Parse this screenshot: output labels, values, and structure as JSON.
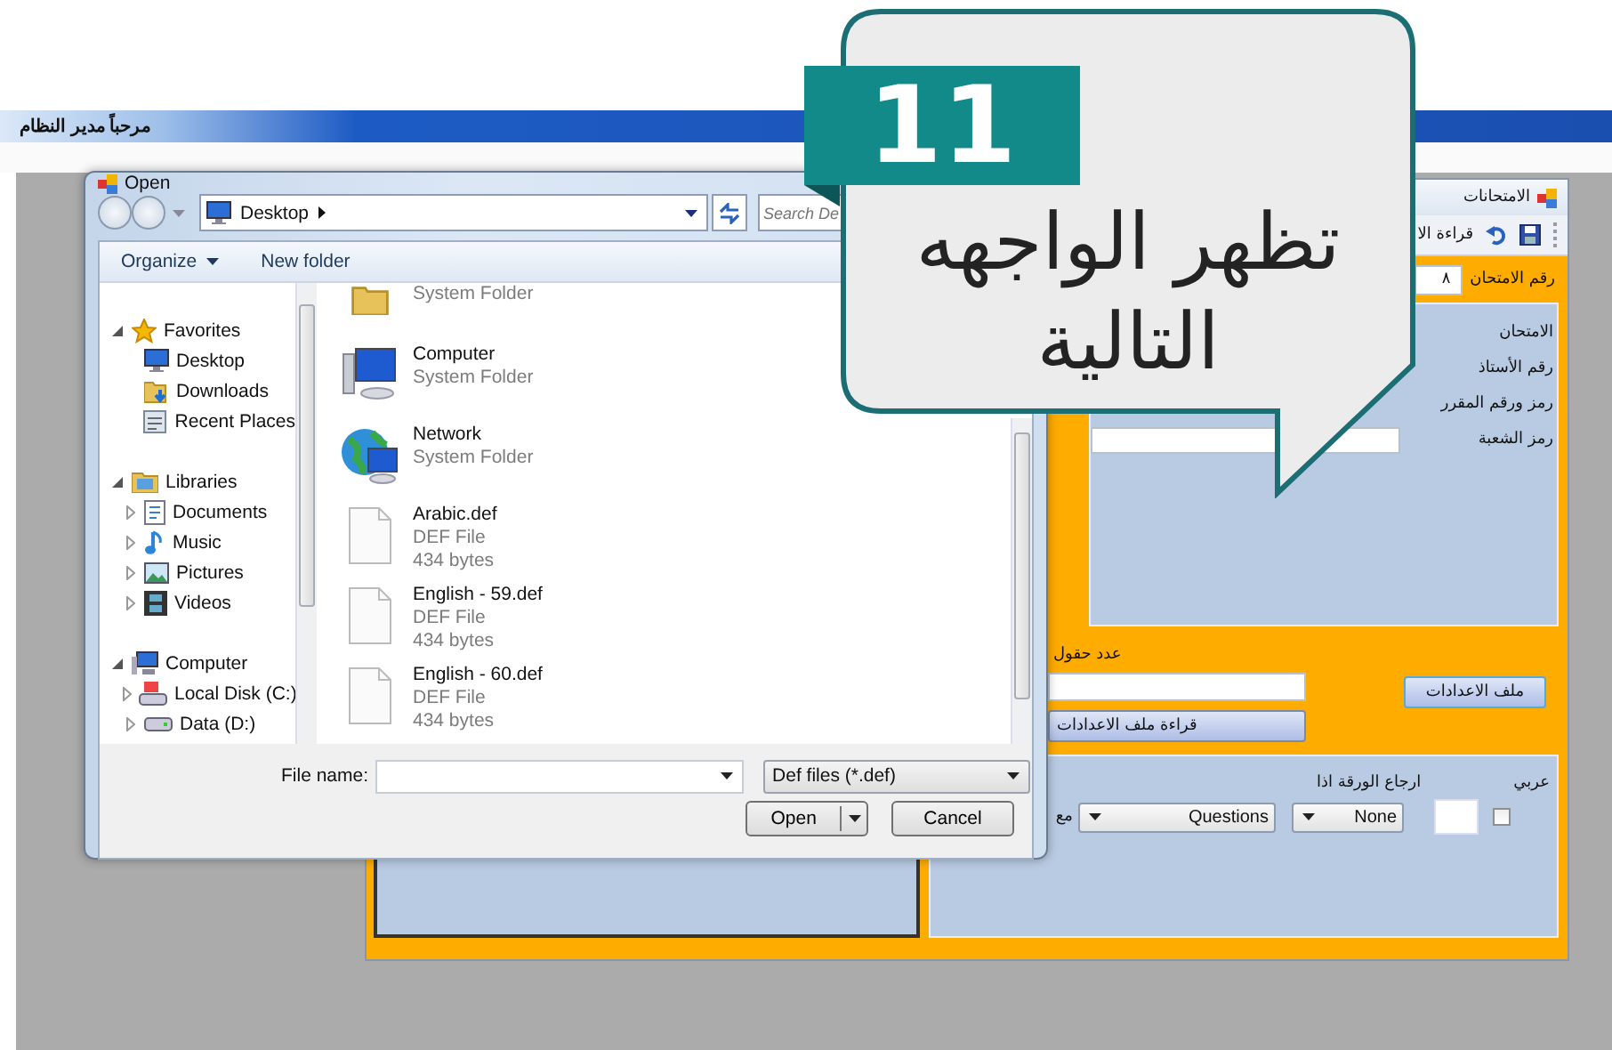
{
  "app_title": "مرحباً مدير النظام",
  "exam_window": {
    "title": "الامتحانات",
    "toolbar_text": "قراءة الا",
    "exam_number": {
      "label": "رقم الامتحان",
      "value": "٨"
    },
    "fields": [
      {
        "kind": "label",
        "label": "الامتحان"
      },
      {
        "kind": "label",
        "label": "رقم الأستاذ"
      },
      {
        "kind": "label",
        "label": "رمز ورقم المقرر"
      },
      {
        "kind": "field",
        "label": "رمز الشعبة"
      }
    ],
    "fields_count_label": "عدد حقول",
    "settings_button": "ملف الاعدادات",
    "read_button": "قراءة ملف الاعدادات",
    "arabic": {
      "label": "عربي",
      "checked": false
    },
    "return_label": "ارجاع الورقة اذا",
    "combos": [
      "Questions",
      "None"
    ],
    "cut_label": "مع"
  },
  "open_dialog": {
    "title": "Open",
    "address": "Desktop",
    "search": {
      "placeholder": "Search De"
    },
    "organize_menu": "Organize",
    "new_folder_button": "New folder",
    "nav": [
      {
        "label": "Favorites",
        "expanded": true,
        "children": [
          {
            "label": "Desktop"
          },
          {
            "label": "Downloads"
          },
          {
            "label": "Recent Places"
          }
        ]
      },
      {
        "label": "Libraries",
        "expanded": true,
        "children": [
          {
            "label": "Documents",
            "expanded": false
          },
          {
            "label": "Music",
            "expanded": false
          },
          {
            "label": "Pictures",
            "expanded": false
          },
          {
            "label": "Videos",
            "expanded": false
          }
        ]
      },
      {
        "label": "Computer",
        "expanded": true,
        "children": [
          {
            "label": "Local Disk (C:)",
            "expanded": false
          },
          {
            "label": "Data (D:)",
            "expanded": false
          }
        ]
      }
    ],
    "files": [
      {
        "kind": "system",
        "type": "System Folder"
      },
      {
        "kind": "system",
        "name": "Computer",
        "type": "System Folder"
      },
      {
        "kind": "system",
        "name": "Network",
        "type": "System Folder"
      },
      {
        "kind": "file",
        "name": "Arabic.def",
        "type": "DEF File",
        "size": "434 bytes"
      },
      {
        "kind": "file",
        "name": "English - 59.def",
        "type": "DEF File",
        "size": "434 bytes"
      },
      {
        "kind": "file",
        "name": "English - 60.def",
        "type": "DEF File",
        "size": "434 bytes"
      }
    ],
    "file_name_label": "File name:",
    "filter": "Def files (*.def)",
    "open_button": "Open",
    "cancel_button": "Cancel"
  },
  "callout": {
    "badge": "11",
    "lines": [
      "تظهر الواجهه",
      "التالية"
    ]
  }
}
